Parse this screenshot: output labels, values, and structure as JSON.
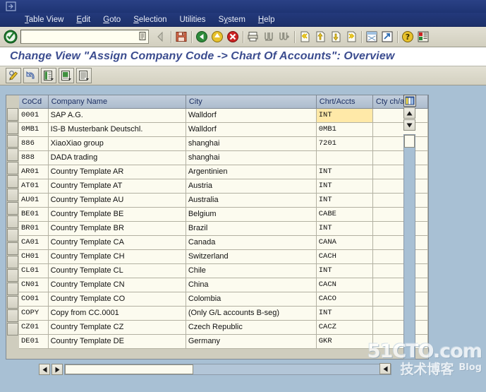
{
  "window": {
    "system_menu_icon": "system-menu-icon"
  },
  "menubar": {
    "items": [
      {
        "label": "Table View",
        "accel": "T"
      },
      {
        "label": "Edit",
        "accel": "E"
      },
      {
        "label": "Goto",
        "accel": "G"
      },
      {
        "label": "Selection",
        "accel": "S"
      },
      {
        "label": "Utilities",
        "accel": "U"
      },
      {
        "label": "System",
        "accel": "y"
      },
      {
        "label": "Help",
        "accel": "H"
      }
    ]
  },
  "toolbar": {
    "enter_icon": "enter-check-icon",
    "command_field": {
      "value": "",
      "placeholder": ""
    },
    "command_dropdown_icon": "command-history-icon",
    "buttons": [
      {
        "name": "back-nav-icon",
        "label": "Back"
      },
      {
        "name": "save-icon",
        "label": "Save"
      },
      {
        "name": "back-green-icon",
        "label": "Back"
      },
      {
        "name": "exit-yellow-icon",
        "label": "Exit"
      },
      {
        "name": "cancel-red-icon",
        "label": "Cancel"
      },
      {
        "name": "print-icon",
        "label": "Print"
      },
      {
        "name": "find-icon",
        "label": "Find"
      },
      {
        "name": "find-next-icon",
        "label": "Find Next"
      },
      {
        "name": "first-page-icon",
        "label": "First Page"
      },
      {
        "name": "previous-page-icon",
        "label": "Previous Page"
      },
      {
        "name": "next-page-icon",
        "label": "Next Page"
      },
      {
        "name": "last-page-icon",
        "label": "Last Page"
      },
      {
        "name": "create-session-icon",
        "label": "Create Session"
      },
      {
        "name": "create-shortcut-icon",
        "label": "Create Shortcut"
      },
      {
        "name": "help-icon",
        "label": "Help"
      },
      {
        "name": "customize-layout-icon",
        "label": "Customize Local Layout"
      }
    ]
  },
  "page": {
    "title": "Change View \"Assign Company Code -> Chart Of Accounts\": Overview"
  },
  "apptoolbar": {
    "buttons": [
      {
        "name": "display-change-icon",
        "label": "Display/Change"
      },
      {
        "name": "undo-arrow-icon",
        "label": "Undo"
      },
      {
        "name": "select-all-icon",
        "label": "Select All"
      },
      {
        "name": "deselect-all-icon",
        "label": "Deselect All"
      },
      {
        "name": "details-icon",
        "label": "Details"
      }
    ]
  },
  "grid": {
    "columns": [
      {
        "key": "cocd",
        "label": "CoCd"
      },
      {
        "key": "name",
        "label": "Company Name"
      },
      {
        "key": "city",
        "label": "City"
      },
      {
        "key": "coa",
        "label": "Chrt/Accts"
      },
      {
        "key": "cty",
        "label": "Cty ch/act"
      }
    ],
    "column_config_icon": "column-config-icon",
    "selected_cell": {
      "row": 0,
      "column": "coa",
      "value": "INT"
    },
    "expand_icon": "value-help-expand-icon",
    "rows": [
      {
        "cocd": "0001",
        "name": "SAP A.G.",
        "city": "Walldorf",
        "coa": "INT",
        "cty": ""
      },
      {
        "cocd": "0MB1",
        "name": "IS-B Musterbank Deutschl.",
        "city": "Walldorf",
        "coa": "0MB1",
        "cty": ""
      },
      {
        "cocd": "886",
        "name": "XiaoXiao group",
        "city": "shanghai",
        "coa": "7201",
        "cty": ""
      },
      {
        "cocd": "888",
        "name": "DADA trading",
        "city": "shanghai",
        "coa": "",
        "cty": ""
      },
      {
        "cocd": "AR01",
        "name": "Country Template AR",
        "city": "Argentinien",
        "coa": "INT",
        "cty": ""
      },
      {
        "cocd": "AT01",
        "name": "Country Template AT",
        "city": "Austria",
        "coa": "INT",
        "cty": ""
      },
      {
        "cocd": "AU01",
        "name": "Country Template AU",
        "city": "Australia",
        "coa": "INT",
        "cty": ""
      },
      {
        "cocd": "BE01",
        "name": "Country Template BE",
        "city": "Belgium",
        "coa": "CABE",
        "cty": ""
      },
      {
        "cocd": "BR01",
        "name": "Country Template BR",
        "city": "Brazil",
        "coa": "INT",
        "cty": ""
      },
      {
        "cocd": "CA01",
        "name": "Country Template CA",
        "city": "Canada",
        "coa": "CANA",
        "cty": ""
      },
      {
        "cocd": "CH01",
        "name": "Country Template CH",
        "city": "Switzerland",
        "coa": "CACH",
        "cty": ""
      },
      {
        "cocd": "CL01",
        "name": "Country Template CL",
        "city": "Chile",
        "coa": "INT",
        "cty": ""
      },
      {
        "cocd": "CN01",
        "name": "Country Template CN",
        "city": "China",
        "coa": "CACN",
        "cty": ""
      },
      {
        "cocd": "CO01",
        "name": "Country Template CO",
        "city": "Colombia",
        "coa": "CACO",
        "cty": ""
      },
      {
        "cocd": "COPY",
        "name": "Copy from CC.0001",
        "city": "(Only G/L accounts B-seg)",
        "coa": "INT",
        "cty": ""
      },
      {
        "cocd": "CZ01",
        "name": "Country Template CZ",
        "city": "Czech Republic",
        "coa": "CACZ",
        "cty": ""
      },
      {
        "cocd": "DE01",
        "name": "Country Template DE",
        "city": "Germany",
        "coa": "GKR",
        "cty": ""
      }
    ]
  },
  "scrollbars": {
    "vertical_up_icon": "scroll-up-icon",
    "vertical_down_icon": "scroll-down-icon",
    "horizontal_left_icon": "scroll-left-icon",
    "horizontal_right_icon": "scroll-right-icon",
    "horizontal_right_outer_icon": "scroll-right-outer-icon"
  },
  "watermark": {
    "line1": "51CTO.com",
    "line2": "技术博客",
    "line3": "Blog"
  },
  "colors": {
    "menu_bar": "#223a7a",
    "title_text": "#3b4c8f",
    "toolbar": "#d6d3c4",
    "grid_header": "#b9c6d6",
    "grid_cell": "#fcfbef",
    "selected_cell": "#ffe9a8",
    "workarea": "#a8c0d4"
  }
}
